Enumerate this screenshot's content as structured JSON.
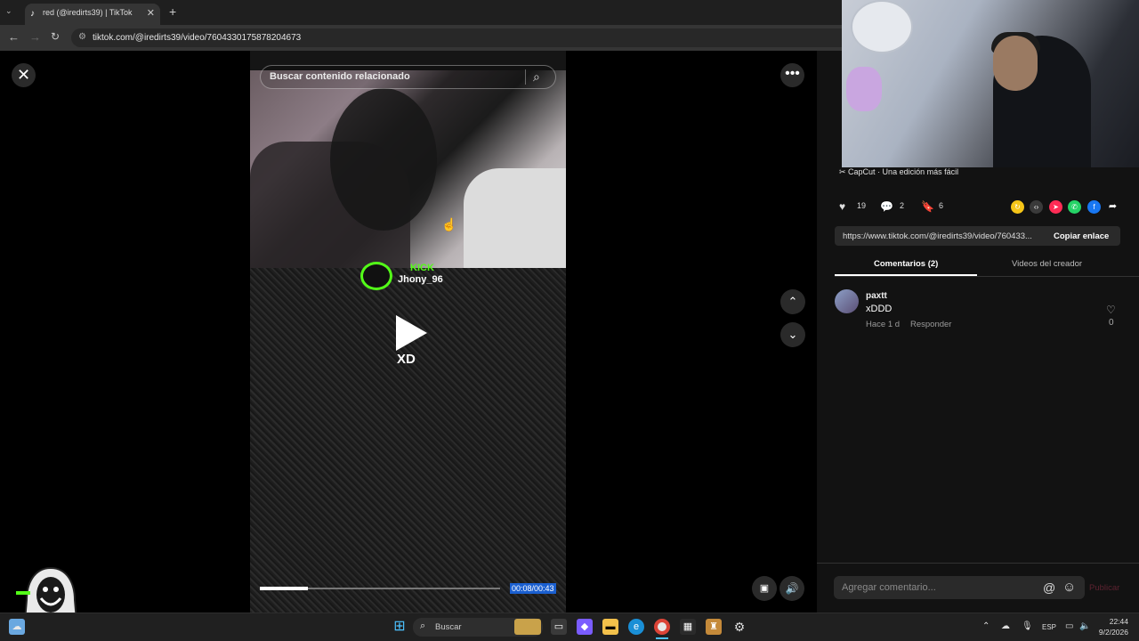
{
  "browser": {
    "tab_title": "red (@iredirts39) | TikTok",
    "tab_close": "✕",
    "new_tab": "+",
    "url": "tiktok.com/@iredirts39/video/7604330175878204673"
  },
  "video": {
    "search_placeholder": "Buscar contenido relacionado",
    "overlay_brand": "KICK",
    "overlay_user": "Jhony_96",
    "overlay_caption": "XD",
    "time": "00:08/00:43",
    "progress_fraction": 0.2
  },
  "panel": {
    "music": "CapCut · Una edición más fácil",
    "likes": "19",
    "comments": "2",
    "saves": "6",
    "share_link": "https://www.tiktok.com/@iredirts39/video/760433...",
    "copy_link": "Copiar enlace",
    "tab_comments": "Comentarios (2)",
    "tab_videos": "Videos del creador",
    "comment": {
      "user": "paxtt",
      "text": "xDDD",
      "time": "Hace 1 d",
      "reply": "Responder",
      "likes": "0"
    },
    "comment_placeholder": "Agregar comentario...",
    "at_symbol": "@",
    "publish": "Publicar"
  },
  "taskbar": {
    "search": "Buscar",
    "lang": "ESP",
    "time": "22:44",
    "date": "9/2/2026"
  },
  "colors": {
    "kick_green": "#53fc18",
    "link_blue": "#1a5fd0",
    "publish_disabled": "#5c2230"
  }
}
